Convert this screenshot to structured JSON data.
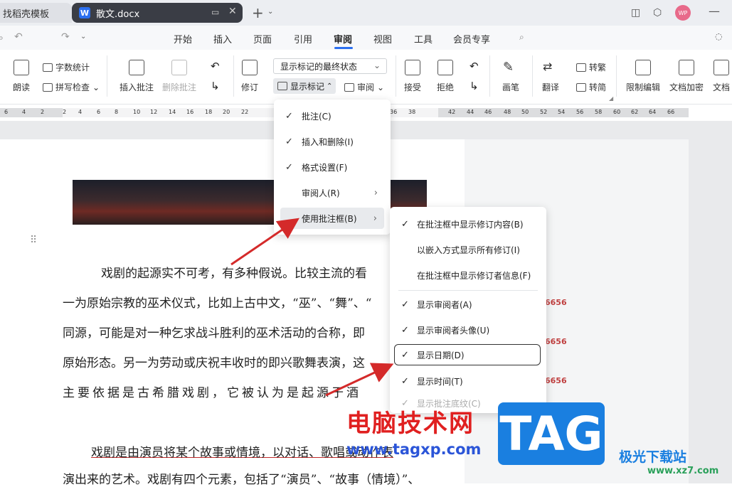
{
  "tabs": {
    "template": "找稻壳模板",
    "doc": "散文.docx",
    "doc_icon": "W"
  },
  "titlebar": {
    "avatar": "WP"
  },
  "menu": [
    "开始",
    "插入",
    "页面",
    "引用",
    "审阅",
    "视图",
    "工具",
    "会员专享"
  ],
  "ribbon": {
    "read": "朗读",
    "word_count": "字数统计",
    "spell_check": "拼写检查",
    "insert_comment": "插入批注",
    "delete_comment": "删除批注",
    "track": "修订",
    "markup_state": "显示标记的最终状态",
    "show_markup": "显示标记",
    "review": "审阅",
    "accept": "接受",
    "reject": "拒绝",
    "pen": "画笔",
    "translate": "翻译",
    "to_traditional": "转繁",
    "to_simplified": "转简",
    "restrict_edit": "限制编辑",
    "doc_encrypt": "文档加密",
    "doc_more": "文档"
  },
  "ruler": [
    "6",
    "4",
    "2",
    "2",
    "4",
    "6",
    "8",
    "10",
    "12",
    "14",
    "16",
    "18",
    "20",
    "22",
    "36",
    "38",
    "42",
    "44",
    "46",
    "48",
    "50",
    "52",
    "54",
    "56",
    "58",
    "60",
    "62",
    "64",
    "66"
  ],
  "document": {
    "lines": [
      "戏剧的起源实不可考，有多种假说。比较主流的看",
      "一为原始宗教的巫术仪式，比如上古中文，“巫”、“舞”、“",
      "同源，可能是对一种乞求战斗胜利的巫术活动的合称，即",
      "原始形态。另一为劳动或庆祝丰收时的即兴歌舞表演，这",
      "主要依据是古希腊戏剧，它被认为是起源于酒",
      "戏剧是由演员将某个故事或情境，以对话、歌唱或动作表",
      "演出来的艺术。戏剧有四个元素，包括了“演员”、“故事（情境）”、"
    ],
    "reviewer_name": "6656"
  },
  "dropdown_show_markup": [
    {
      "label": "批注(C)",
      "checked": true
    },
    {
      "label": "插入和删除(I)",
      "checked": true
    },
    {
      "label": "格式设置(F)",
      "checked": true
    },
    {
      "label": "审阅人(R)",
      "checked": false,
      "submenu": true
    },
    {
      "label": "使用批注框(B)",
      "checked": false,
      "submenu": true
    }
  ],
  "dropdown_balloons": [
    {
      "label": "在批注框中显示修订内容(B)",
      "checked": true
    },
    {
      "label": "以嵌入方式显示所有修订(I)",
      "checked": false
    },
    {
      "label": "在批注框中显示修订者信息(F)",
      "checked": false
    },
    {
      "label": "显示审阅者(A)",
      "checked": true
    },
    {
      "label": "显示审阅者头像(U)",
      "checked": true
    },
    {
      "label": "显示日期(D)",
      "checked": true
    },
    {
      "label": "显示时间(T)",
      "checked": true
    },
    {
      "label": "显示批注底纹(C)",
      "checked": true
    }
  ],
  "watermark": {
    "text": "电脑技术网",
    "url": "www.tagxp.com",
    "tag": "TAG",
    "logo": "极光下载站",
    "logo_url": "www.xz7.com"
  },
  "colors": {
    "accent": "#2b6ff0",
    "arrow": "#d42a2a",
    "revision": "#3b2fb0"
  }
}
